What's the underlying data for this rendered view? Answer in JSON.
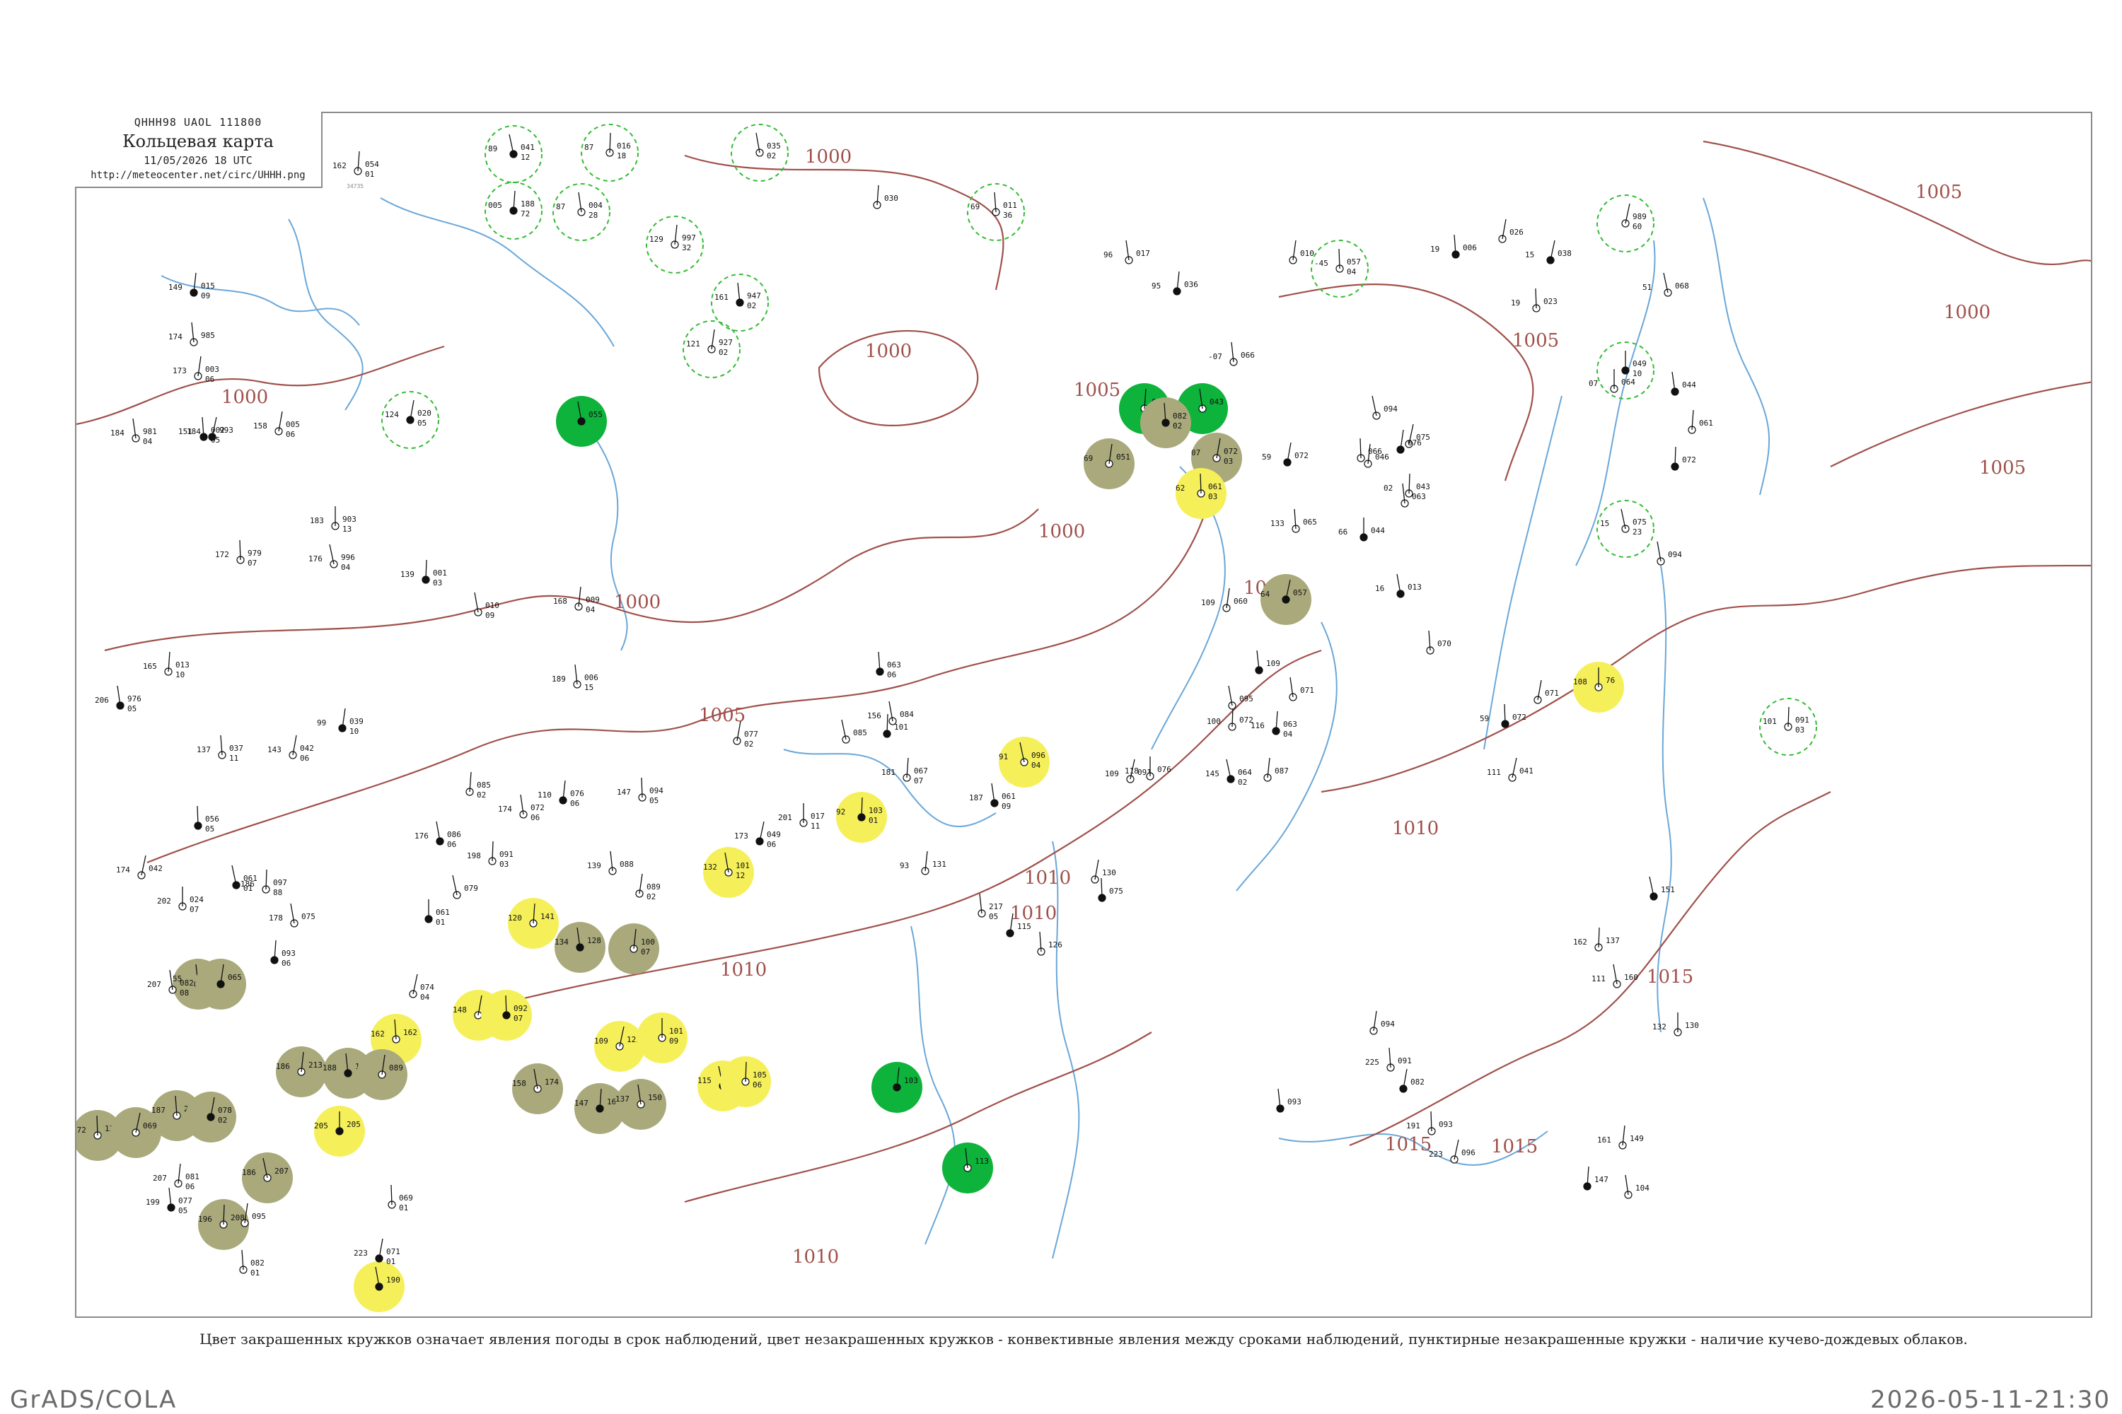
{
  "header": {
    "code": "QHHH98  UAOL  111800",
    "title": "Кольцевая карта",
    "datetime": "11/05/2026 18 UTC",
    "url": "http://meteocenter.net/circ/UHHH.png"
  },
  "caption": "Цвет закрашенных кружков означает явления погоды в срок наблюдений, цвет незакрашенных кружков - конвективные явления между сроками наблюдений, пунктирные незакрашенные кружки - наличие кучево-дождевых облаков.",
  "footer": {
    "left": "GrADS/COLA",
    "right": "2026-05-11-21:30"
  },
  "colors": {
    "isobar": "#a0504a",
    "river": "#6aa7d8",
    "filled_green": "#0db33a",
    "filled_yellow": "#f5f05a",
    "filled_olive": "#a9a97c",
    "dashed_green": "#33bb33",
    "frame": "#8a8a8a"
  },
  "isobar_labels": [
    {
      "value": "1000"
    },
    {
      "value": "1000"
    },
    {
      "value": "1000"
    },
    {
      "value": "1000"
    },
    {
      "value": "1000"
    },
    {
      "value": "1005"
    },
    {
      "value": "1005"
    },
    {
      "value": "1005"
    },
    {
      "value": "1005"
    },
    {
      "value": "1005"
    },
    {
      "value": "1010"
    },
    {
      "value": "1010"
    },
    {
      "value": "1010"
    },
    {
      "value": "1010"
    },
    {
      "value": "1010"
    },
    {
      "value": "1015"
    },
    {
      "value": "1015"
    },
    {
      "value": "1015"
    },
    {
      "value": "1005"
    },
    {
      "value": "1000"
    }
  ],
  "stations": [
    {
      "t": "041",
      "d": "12",
      "p": "89",
      "id": "",
      "mark": "dashed-green"
    },
    {
      "t": "016",
      "d": "18",
      "p": "87",
      "id": "",
      "mark": "dashed-green"
    },
    {
      "t": "035",
      "d": "02",
      "p": "",
      "id": "",
      "mark": "dashed-green"
    },
    {
      "t": "188",
      "d": "72",
      "p": "005",
      "id": "",
      "mark": "dashed-green"
    },
    {
      "t": "004",
      "d": "28",
      "p": "87",
      "id": "",
      "mark": "dashed-green"
    },
    {
      "t": "997",
      "d": "32",
      "p": "129",
      "id": "",
      "mark": "dashed-green"
    },
    {
      "t": "947",
      "d": "02",
      "p": "161",
      "id": "",
      "mark": "dashed-green"
    },
    {
      "t": "927",
      "d": "02",
      "p": "121",
      "id": "",
      "mark": "dashed-green"
    },
    {
      "t": "011",
      "d": "36",
      "p": "69",
      "id": "",
      "mark": "dashed-green"
    },
    {
      "t": "020",
      "d": "05",
      "p": "124",
      "id": "",
      "mark": "dashed-green"
    },
    {
      "t": "057",
      "d": "04",
      "p": "-45",
      "id": "",
      "mark": "dashed-green"
    },
    {
      "t": "989",
      "d": "60",
      "p": "",
      "id": "",
      "mark": "dashed-green"
    },
    {
      "t": "049",
      "d": "10",
      "p": "",
      "id": "",
      "mark": "dashed-green"
    },
    {
      "t": "075",
      "d": "23",
      "p": "15",
      "id": "",
      "mark": "dashed-green"
    },
    {
      "t": "091",
      "d": "03",
      "p": "101",
      "id": "",
      "mark": "dashed-green"
    },
    {
      "t": "055",
      "d": "",
      "p": "",
      "id": "",
      "mark": "filled-green"
    },
    {
      "t": "041",
      "d": "",
      "p": "",
      "id": "",
      "mark": "filled-green"
    },
    {
      "t": "043",
      "d": "",
      "p": "",
      "id": "",
      "mark": "filled-green"
    },
    {
      "t": "103",
      "d": "",
      "p": "",
      "id": "",
      "mark": "filled-green"
    },
    {
      "t": "113",
      "d": "",
      "p": "",
      "id": "",
      "mark": "filled-green"
    },
    {
      "t": "051",
      "d": "",
      "p": "69",
      "id": "",
      "mark": "filled-olive"
    },
    {
      "t": "082",
      "d": "02",
      "p": "",
      "id": "",
      "mark": "filled-olive"
    },
    {
      "t": "072",
      "d": "03",
      "p": "07",
      "id": "",
      "mark": "filled-olive"
    },
    {
      "t": "061",
      "d": "03",
      "p": "62",
      "id": "",
      "mark": "filled-yellow"
    },
    {
      "t": "057",
      "d": "",
      "p": "64",
      "id": "",
      "mark": "filled-olive"
    },
    {
      "t": "76",
      "d": "",
      "p": "108",
      "id": "",
      "mark": "filled-yellow"
    },
    {
      "t": "096",
      "d": "04",
      "p": "91",
      "id": "",
      "mark": "filled-yellow"
    },
    {
      "t": "103",
      "d": "01",
      "p": "92",
      "id": "",
      "mark": "filled-yellow"
    },
    {
      "t": "101",
      "d": "12",
      "p": "132",
      "id": "",
      "mark": "filled-yellow"
    },
    {
      "t": "141",
      "d": "",
      "p": "120",
      "id": "",
      "mark": "filled-yellow"
    },
    {
      "t": "128",
      "d": "",
      "p": "134",
      "id": "",
      "mark": "filled-olive"
    },
    {
      "t": "100",
      "d": "07",
      "p": "",
      "id": "",
      "mark": "filled-olive"
    },
    {
      "t": "179",
      "d": "",
      "p": "55",
      "id": "",
      "mark": "filled-olive"
    },
    {
      "t": "065",
      "d": "",
      "p": "",
      "id": "",
      "mark": "filled-olive"
    },
    {
      "t": "162",
      "d": "",
      "p": "162",
      "id": "",
      "mark": "filled-yellow"
    },
    {
      "t": "181",
      "d": "",
      "p": "148",
      "id": "",
      "mark": "filled-yellow"
    },
    {
      "t": "092",
      "d": "07",
      "p": "",
      "id": "",
      "mark": "filled-yellow"
    },
    {
      "t": "122",
      "d": "",
      "p": "109",
      "id": "",
      "mark": "filled-yellow"
    },
    {
      "t": "101",
      "d": "09",
      "p": "",
      "id": "",
      "mark": "filled-yellow"
    },
    {
      "t": "118",
      "d": "",
      "p": "115",
      "id": "",
      "mark": "filled-yellow"
    },
    {
      "t": "105",
      "d": "06",
      "p": "",
      "id": "",
      "mark": "filled-yellow"
    },
    {
      "t": "174",
      "d": "",
      "p": "158",
      "id": "",
      "mark": "filled-olive"
    },
    {
      "t": "160",
      "d": "",
      "p": "147",
      "id": "",
      "mark": "filled-olive"
    },
    {
      "t": "150",
      "d": "",
      "p": "137",
      "id": "",
      "mark": "filled-olive"
    },
    {
      "t": "213",
      "d": "",
      "p": "186",
      "id": "",
      "mark": "filled-olive"
    },
    {
      "t": "197",
      "d": "",
      "p": "188",
      "id": "",
      "mark": "filled-olive"
    },
    {
      "t": "089",
      "d": "",
      "p": "",
      "id": "",
      "mark": "filled-olive"
    },
    {
      "t": "221",
      "d": "",
      "p": "187",
      "id": "",
      "mark": "filled-olive"
    },
    {
      "t": "078",
      "d": "02",
      "p": "",
      "id": "",
      "mark": "filled-olive"
    },
    {
      "t": "132",
      "d": "",
      "p": "172",
      "id": "",
      "mark": "filled-olive"
    },
    {
      "t": "069",
      "d": "",
      "p": "",
      "id": "",
      "mark": "filled-olive"
    },
    {
      "t": "205",
      "d": "",
      "p": "205",
      "id": "",
      "mark": "filled-yellow"
    },
    {
      "t": "207",
      "d": "",
      "p": "186",
      "id": "",
      "mark": "filled-olive"
    },
    {
      "t": "208",
      "d": "",
      "p": "196",
      "id": "",
      "mark": "filled-olive"
    },
    {
      "t": "190",
      "d": "",
      "p": "",
      "id": "",
      "mark": "filled-yellow"
    },
    {
      "t": "054",
      "d": "01",
      "p": "162",
      "id": "34735",
      "mark": "none"
    },
    {
      "t": "981",
      "d": "04",
      "p": "184",
      "id": "",
      "mark": "none"
    },
    {
      "t": "015",
      "d": "09",
      "p": "149",
      "id": "",
      "mark": "none"
    },
    {
      "t": "985",
      "d": "",
      "p": "174",
      "id": "",
      "mark": "none"
    },
    {
      "t": "003",
      "d": "06",
      "p": "173",
      "id": "",
      "mark": "none"
    },
    {
      "t": "002",
      "d": "05",
      "p": "151",
      "id": "",
      "mark": "none"
    },
    {
      "t": "005",
      "d": "06",
      "p": "158",
      "id": "",
      "mark": "none"
    },
    {
      "t": "979",
      "d": "07",
      "p": "172",
      "id": "",
      "mark": "none"
    },
    {
      "t": "993",
      "d": "",
      "p": "184",
      "id": "",
      "mark": "none"
    },
    {
      "t": "903",
      "d": "13",
      "p": "183",
      "id": "",
      "mark": "none"
    },
    {
      "t": "996",
      "d": "04",
      "p": "176",
      "id": "",
      "mark": "none"
    },
    {
      "t": "001",
      "d": "03",
      "p": "139",
      "id": "",
      "mark": "none"
    },
    {
      "t": "010",
      "d": "09",
      "p": "",
      "id": "",
      "mark": "none"
    },
    {
      "t": "013",
      "d": "10",
      "p": "165",
      "id": "",
      "mark": "none"
    },
    {
      "t": "976",
      "d": "05",
      "p": "206",
      "id": "",
      "mark": "none"
    },
    {
      "t": "009",
      "d": "04",
      "p": "168",
      "id": "",
      "mark": "none"
    },
    {
      "t": "006",
      "d": "15",
      "p": "189",
      "id": "",
      "mark": "none"
    },
    {
      "t": "039",
      "d": "10",
      "p": "99",
      "id": "",
      "mark": "none"
    },
    {
      "t": "037",
      "d": "11",
      "p": "137",
      "id": "",
      "mark": "none"
    },
    {
      "t": "042",
      "d": "06",
      "p": "143",
      "id": "",
      "mark": "none"
    },
    {
      "t": "056",
      "d": "05",
      "p": "",
      "id": "",
      "mark": "none"
    },
    {
      "t": "042",
      "d": "",
      "p": "174",
      "id": "",
      "mark": "none"
    },
    {
      "t": "024",
      "d": "07",
      "p": "202",
      "id": "",
      "mark": "none"
    },
    {
      "t": "061",
      "d": "01",
      "p": "",
      "id": "",
      "mark": "none"
    },
    {
      "t": "097",
      "d": "88",
      "p": "186",
      "id": "",
      "mark": "none"
    },
    {
      "t": "075",
      "d": "",
      "p": "178",
      "id": "",
      "mark": "none"
    },
    {
      "t": "093",
      "d": "06",
      "p": "",
      "id": "",
      "mark": "none"
    },
    {
      "t": "082",
      "d": "08",
      "p": "207",
      "id": "",
      "mark": "none"
    },
    {
      "t": "081",
      "d": "06",
      "p": "207",
      "id": "",
      "mark": "none"
    },
    {
      "t": "077",
      "d": "05",
      "p": "199",
      "id": "",
      "mark": "none"
    },
    {
      "t": "095",
      "d": "",
      "p": "",
      "id": "",
      "mark": "none"
    },
    {
      "t": "082",
      "d": "01",
      "p": "",
      "id": "",
      "mark": "none"
    },
    {
      "t": "071",
      "d": "01",
      "p": "223",
      "id": "",
      "mark": "none"
    },
    {
      "t": "069",
      "d": "01",
      "p": "",
      "id": "",
      "mark": "none"
    },
    {
      "t": "074",
      "d": "04",
      "p": "",
      "id": "",
      "mark": "none"
    },
    {
      "t": "061",
      "d": "01",
      "p": "",
      "id": "",
      "mark": "none"
    },
    {
      "t": "079",
      "d": "",
      "p": "",
      "id": "",
      "mark": "none"
    },
    {
      "t": "091",
      "d": "03",
      "p": "198",
      "id": "",
      "mark": "none"
    },
    {
      "t": "086",
      "d": "06",
      "p": "176",
      "id": "",
      "mark": "none"
    },
    {
      "t": "085",
      "d": "02",
      "p": "",
      "id": "",
      "mark": "none"
    },
    {
      "t": "072",
      "d": "06",
      "p": "174",
      "id": "",
      "mark": "none"
    },
    {
      "t": "076",
      "d": "06",
      "p": "110",
      "id": "",
      "mark": "none"
    },
    {
      "t": "088",
      "d": "",
      "p": "139",
      "id": "",
      "mark": "none"
    },
    {
      "t": "089",
      "d": "02",
      "p": "",
      "id": "",
      "mark": "none"
    },
    {
      "t": "063",
      "d": "06",
      "p": "",
      "id": "",
      "mark": "none"
    },
    {
      "t": "077",
      "d": "02",
      "p": "",
      "id": "",
      "mark": "none"
    },
    {
      "t": "094",
      "d": "05",
      "p": "147",
      "id": "",
      "mark": "none"
    },
    {
      "t": "049",
      "d": "06",
      "p": "173",
      "id": "",
      "mark": "none"
    },
    {
      "t": "017",
      "d": "11",
      "p": "201",
      "id": "",
      "mark": "none"
    },
    {
      "t": "085",
      "d": "",
      "p": "",
      "id": "",
      "mark": "none"
    },
    {
      "t": "101",
      "d": "",
      "p": "",
      "id": "",
      "mark": "none"
    },
    {
      "t": "084",
      "d": "",
      "p": "156",
      "id": "",
      "mark": "none"
    },
    {
      "t": "067",
      "d": "07",
      "p": "181",
      "id": "",
      "mark": "none"
    },
    {
      "t": "061",
      "d": "09",
      "p": "187",
      "id": "",
      "mark": "none"
    },
    {
      "t": "131",
      "d": "",
      "p": "93",
      "id": "",
      "mark": "none"
    },
    {
      "t": "217",
      "d": "05",
      "p": "",
      "id": "",
      "mark": "none"
    },
    {
      "t": "115",
      "d": "",
      "p": "",
      "id": "",
      "mark": "none"
    },
    {
      "t": "126",
      "d": "",
      "p": "",
      "id": "",
      "mark": "none"
    },
    {
      "t": "130",
      "d": "",
      "p": "",
      "id": "",
      "mark": "none"
    },
    {
      "t": "075",
      "d": "",
      "p": "",
      "id": "",
      "mark": "none"
    },
    {
      "t": "091",
      "d": "",
      "p": "109",
      "id": "",
      "mark": "none"
    },
    {
      "t": "076",
      "d": "",
      "p": "118",
      "id": "",
      "mark": "none"
    },
    {
      "t": "064",
      "d": "02",
      "p": "145",
      "id": "",
      "mark": "none"
    },
    {
      "t": "072",
      "d": "",
      "p": "100",
      "id": "",
      "mark": "none"
    },
    {
      "t": "095",
      "d": "",
      "p": "",
      "id": "",
      "mark": "none"
    },
    {
      "t": "063",
      "d": "04",
      "p": "116",
      "id": "",
      "mark": "none"
    },
    {
      "t": "071",
      "d": "",
      "p": "",
      "id": "",
      "mark": "none"
    },
    {
      "t": "087",
      "d": "",
      "p": "",
      "id": "",
      "mark": "none"
    },
    {
      "t": "109",
      "d": "",
      "p": "",
      "id": "",
      "mark": "none"
    },
    {
      "t": "060",
      "d": "",
      "p": "109",
      "id": "",
      "mark": "none"
    },
    {
      "t": "065",
      "d": "",
      "p": "133",
      "id": "",
      "mark": "none"
    },
    {
      "t": "072",
      "d": "",
      "p": "59",
      "id": "",
      "mark": "none"
    },
    {
      "t": "066",
      "d": "",
      "p": "",
      "id": "",
      "mark": "none"
    },
    {
      "t": "075",
      "d": "",
      "p": "",
      "id": "",
      "mark": "none"
    },
    {
      "t": "044",
      "d": "",
      "p": "66",
      "id": "",
      "mark": "none"
    },
    {
      "t": "094",
      "d": "",
      "p": "",
      "id": "",
      "mark": "none"
    },
    {
      "t": "043",
      "d": "",
      "p": "02",
      "id": "",
      "mark": "none"
    },
    {
      "t": "013",
      "d": "",
      "p": "16",
      "id": "",
      "mark": "none"
    },
    {
      "t": "030",
      "d": "",
      "p": "",
      "id": "",
      "mark": "none"
    },
    {
      "t": "017",
      "d": "",
      "p": "96",
      "id": "",
      "mark": "none"
    },
    {
      "t": "036",
      "d": "",
      "p": "95",
      "id": "",
      "mark": "none"
    },
    {
      "t": "066",
      "d": "",
      "p": "-07",
      "id": "",
      "mark": "none"
    },
    {
      "t": "010",
      "d": "",
      "p": "",
      "id": "",
      "mark": "none"
    },
    {
      "t": "006",
      "d": "",
      "p": "19",
      "id": "",
      "mark": "none"
    },
    {
      "t": "026",
      "d": "",
      "p": "",
      "id": "",
      "mark": "none"
    },
    {
      "t": "023",
      "d": "",
      "p": "19",
      "id": "",
      "mark": "none"
    },
    {
      "t": "038",
      "d": "",
      "p": "15",
      "id": "",
      "mark": "none"
    },
    {
      "t": "064",
      "d": "",
      "p": "07",
      "id": "",
      "mark": "none"
    },
    {
      "t": "068",
      "d": "",
      "p": "51",
      "id": "",
      "mark": "none"
    },
    {
      "t": "072",
      "d": "",
      "p": "",
      "id": "",
      "mark": "none"
    },
    {
      "t": "094",
      "d": "",
      "p": "",
      "id": "",
      "mark": "none"
    },
    {
      "t": "061",
      "d": "",
      "p": "",
      "id": "",
      "mark": "none"
    },
    {
      "t": "044",
      "d": "",
      "p": "",
      "id": "",
      "mark": "none"
    },
    {
      "t": "046",
      "d": "",
      "p": "",
      "id": "",
      "mark": "none"
    },
    {
      "t": "063",
      "d": "",
      "p": "",
      "id": "",
      "mark": "none"
    },
    {
      "t": "076",
      "d": "",
      "p": "",
      "id": "",
      "mark": "none"
    },
    {
      "t": "070",
      "d": "",
      "p": "",
      "id": "",
      "mark": "none"
    },
    {
      "t": "071",
      "d": "",
      "p": "",
      "id": "",
      "mark": "none"
    },
    {
      "t": "072",
      "d": "",
      "p": "59",
      "id": "",
      "mark": "none"
    },
    {
      "t": "041",
      "d": "",
      "p": "111",
      "id": "",
      "mark": "none"
    },
    {
      "t": "130",
      "d": "",
      "p": "132",
      "id": "",
      "mark": "none"
    },
    {
      "t": "151",
      "d": "",
      "p": "",
      "id": "",
      "mark": "none"
    },
    {
      "t": "137",
      "d": "",
      "p": "162",
      "id": "",
      "mark": "none"
    },
    {
      "t": "160",
      "d": "",
      "p": "111",
      "id": "",
      "mark": "none"
    },
    {
      "t": "147",
      "d": "",
      "p": "",
      "id": "",
      "mark": "none"
    },
    {
      "t": "104",
      "d": "",
      "p": "",
      "id": "",
      "mark": "none"
    },
    {
      "t": "149",
      "d": "",
      "p": "161",
      "id": "",
      "mark": "none"
    },
    {
      "t": "093",
      "d": "",
      "p": "",
      "id": "",
      "mark": "none"
    },
    {
      "t": "094",
      "d": "",
      "p": "",
      "id": "",
      "mark": "none"
    },
    {
      "t": "091",
      "d": "",
      "p": "225",
      "id": "",
      "mark": "none"
    },
    {
      "t": "082",
      "d": "",
      "p": "",
      "id": "",
      "mark": "none"
    },
    {
      "t": "093",
      "d": "",
      "p": "191",
      "id": "",
      "mark": "none"
    },
    {
      "t": "096",
      "d": "",
      "p": "223",
      "id": "",
      "mark": "none"
    }
  ]
}
